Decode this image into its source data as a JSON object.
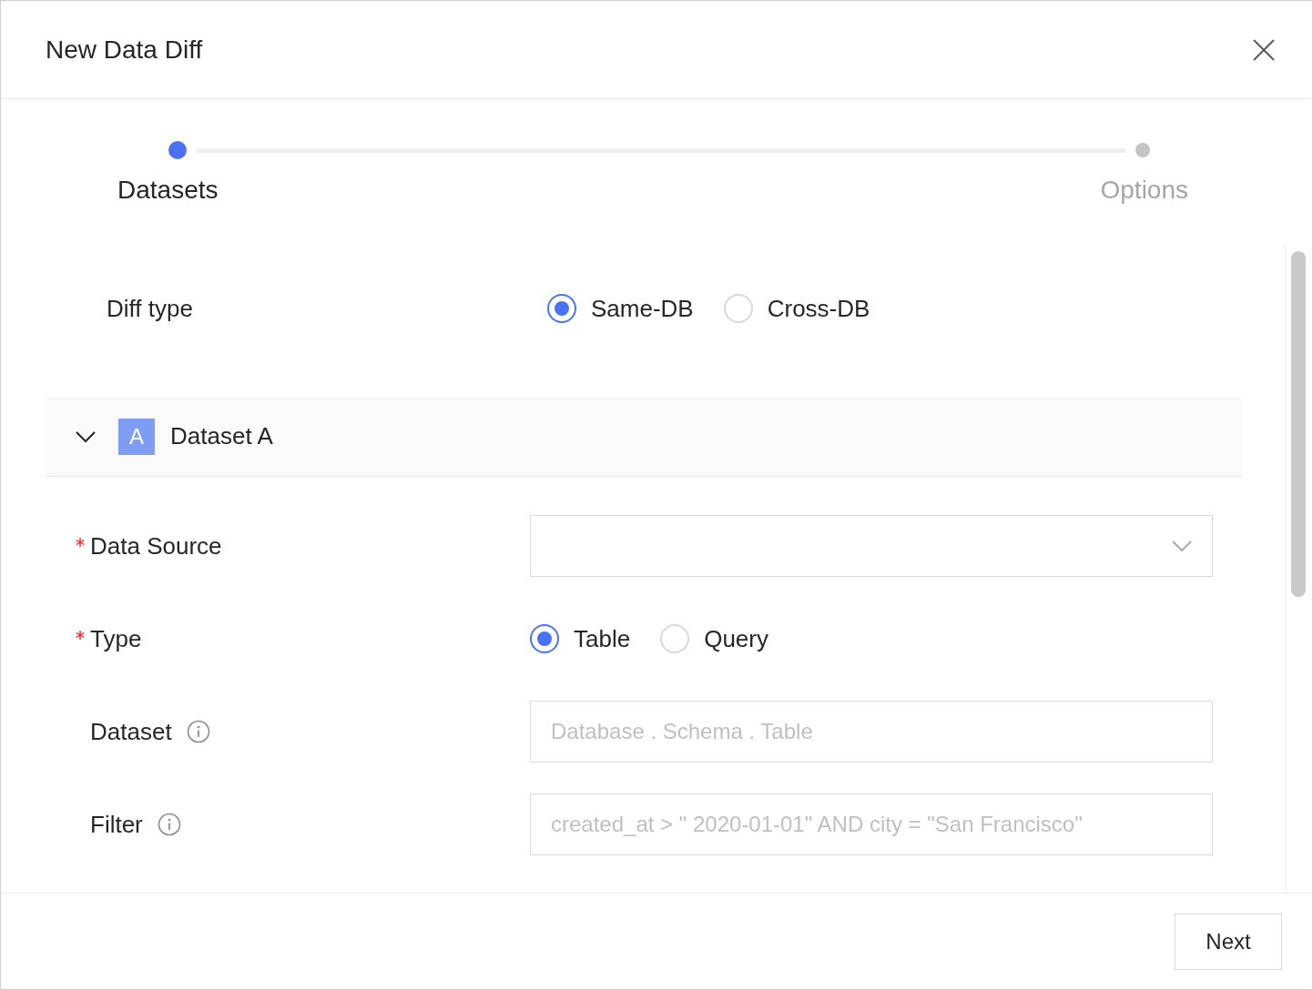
{
  "dialog": {
    "title": "New Data Diff"
  },
  "steps": [
    {
      "label": "Datasets",
      "selected": true
    },
    {
      "label": "Options",
      "selected": false
    }
  ],
  "diff_type": {
    "label": "Diff type",
    "options": [
      {
        "label": "Same-DB",
        "selected": true
      },
      {
        "label": "Cross-DB",
        "selected": false
      }
    ]
  },
  "section": {
    "title": "Dataset A",
    "badge": "A",
    "expanded": true
  },
  "fields": [
    {
      "kind": "select",
      "label": "Data Source",
      "required": true
    },
    {
      "kind": "radio",
      "label": "Type",
      "required": true,
      "options": [
        {
          "label": "Table",
          "selected": true
        },
        {
          "label": "Query",
          "selected": false
        }
      ]
    },
    {
      "kind": "input",
      "label": "Dataset",
      "info": true,
      "placeholder": "Database . Schema . Table"
    },
    {
      "kind": "input",
      "label": "Filter",
      "info": true,
      "placeholder": "created_at > \" 2020-01-01\" AND city = \"San Francisco\""
    }
  ],
  "footer": {
    "next_button": "Next"
  }
}
